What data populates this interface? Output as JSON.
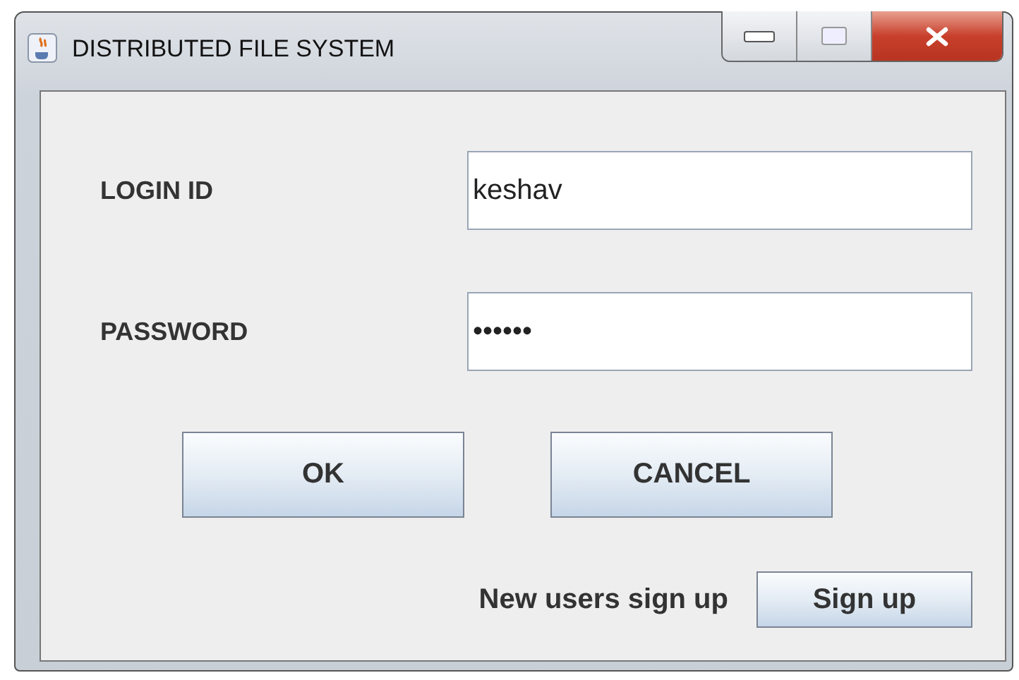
{
  "window": {
    "title": "DISTRIBUTED FILE SYSTEM"
  },
  "fields": [
    {
      "label": "LOGIN ID",
      "value": "keshav"
    },
    {
      "label": "PASSWORD",
      "value": "••••••"
    }
  ],
  "buttons": [
    "OK",
    "CANCEL"
  ],
  "signup": {
    "text": "New users sign up",
    "button": "Sign up"
  }
}
